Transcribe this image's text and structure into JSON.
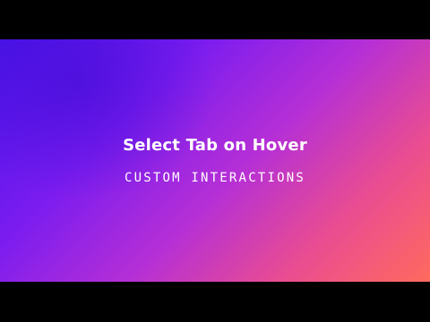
{
  "slide": {
    "title": "Select Tab on Hover",
    "subtitle": "CUSTOM INTERACTIONS"
  },
  "colors": {
    "letterbox": "#000000",
    "gradient_start": "#4a14e8",
    "gradient_mid": "#b52fd6",
    "gradient_end": "#ff6a5e",
    "text": "#ffffff"
  }
}
